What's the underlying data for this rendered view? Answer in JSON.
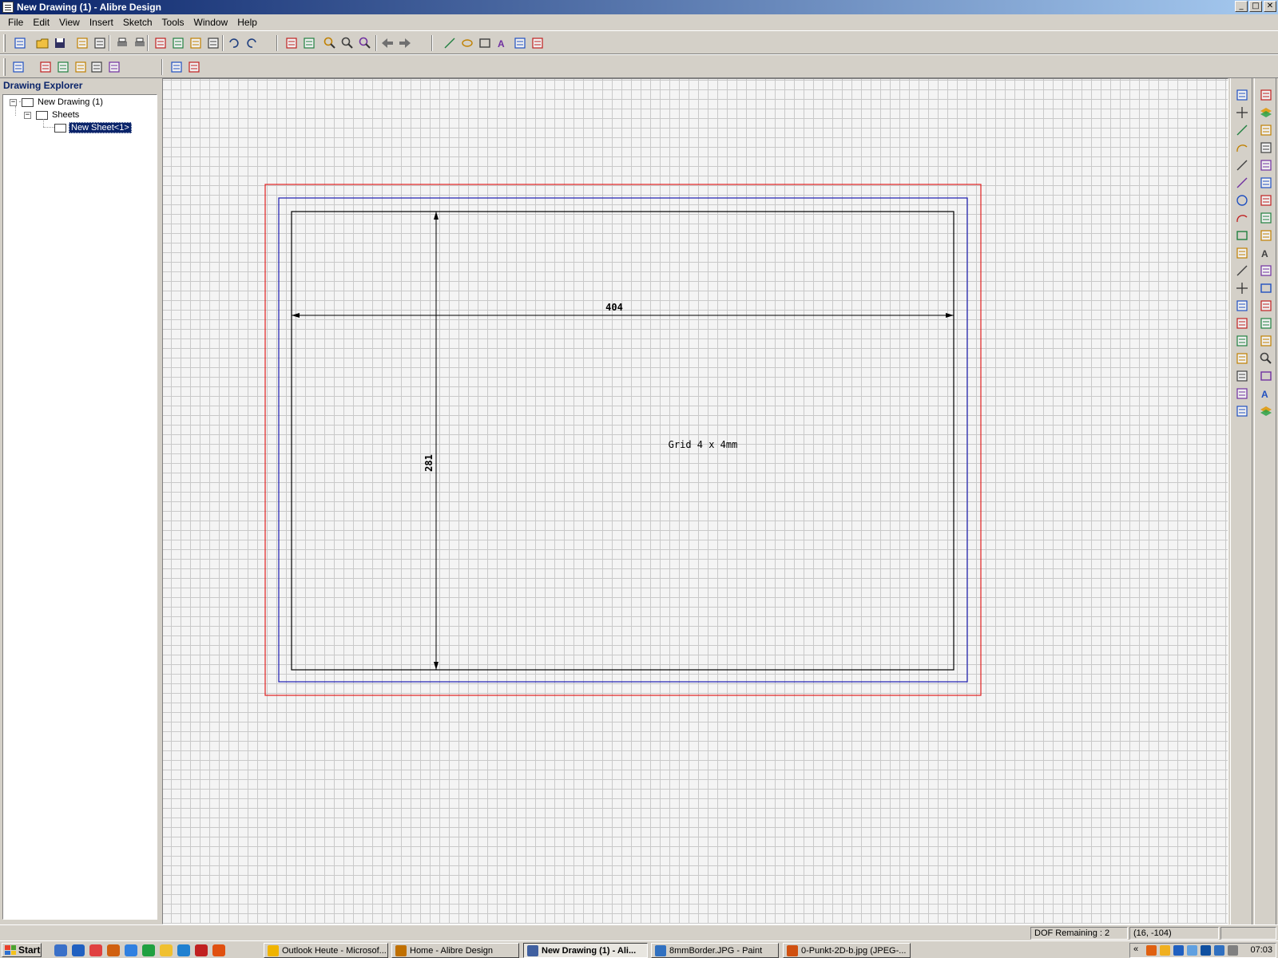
{
  "window": {
    "title": "New Drawing (1) - Alibre Design",
    "minimize": "_",
    "maximize": "□",
    "close": "✕"
  },
  "menu": [
    "File",
    "Edit",
    "View",
    "Insert",
    "Sketch",
    "Tools",
    "Window",
    "Help"
  ],
  "toolbar1": [
    "new-icon",
    "open-icon",
    "save-icon",
    "copy-doc-icon",
    "paste-doc-icon",
    "print-icon",
    "print-preview-icon",
    "cut-icon",
    "copy-icon",
    "paste-icon",
    "delete-icon",
    "undo-icon",
    "redo-icon",
    "select-icon",
    "select-window-icon",
    "zoom-in-icon",
    "zoom-window-icon",
    "zoom-icon",
    "back-arrow-icon",
    "forward-arrow-icon",
    "sketch-line-icon",
    "ellipse-icon",
    "rectangle-icon",
    "text-icon",
    "fill-icon",
    "hatch-icon"
  ],
  "toolbar2": [
    "insert-view-icon",
    "standard-view-icon",
    "section-view-icon",
    "detail-view-icon",
    "broken-view-icon",
    "dimension-view-icon",
    "sheet-add-icon",
    "sheet-remove-icon"
  ],
  "explorer": {
    "title": "Drawing Explorer",
    "tree": {
      "root": "New Drawing (1)",
      "folder": "Sheets",
      "sheet": "New Sheet<1>"
    }
  },
  "drawing": {
    "dimension_horizontal": "404",
    "dimension_vertical": "281",
    "note": "Grid 4 x 4mm",
    "colors": {
      "grid": "#c9c9c9",
      "outer_border": "#e02020",
      "inner_border": "#1a1ab0",
      "frame": "#000000",
      "background": "#f4f4f4"
    }
  },
  "right_toolbar1": [
    "sketch-icon",
    "crosshair-icon",
    "line-icon",
    "arc-dot-icon",
    "diagonal-line-icon",
    "line2-icon",
    "circle-icon",
    "arc-icon",
    "rectangle-icon",
    "polygon-icon",
    "spline-icon",
    "point-icon",
    "hatch-icon",
    "trim-icon",
    "extend-icon",
    "fillet-icon",
    "chamfer-icon",
    "offset-icon",
    "mirror-icon"
  ],
  "right_toolbar2": [
    "new-sheet-icon",
    "layers-icon",
    "properties-icon",
    "bom-icon",
    "balloon-icon",
    "weld-icon",
    "surface-finish-icon",
    "datum-icon",
    "center-mark-icon",
    "note-icon",
    "gd-t-icon",
    "hole-table-icon",
    "revision-icon",
    "check-icon",
    "angle-icon",
    "search-icon",
    "table-icon",
    "text-style-icon",
    "layer-stack-icon"
  ],
  "status": {
    "dof": "DOF Remaining : 2",
    "coords": "(16, -104)"
  },
  "taskbar": {
    "start": "Start",
    "tasks": [
      {
        "label": "Outlook Heute - Microsof...",
        "color": "#f0b400"
      },
      {
        "label": "Home - Alibre Design",
        "color": "#c07000"
      },
      {
        "label": "New Drawing (1) - Ali...",
        "color": "#4060a0"
      },
      {
        "label": "8mmBorder.JPG - Paint",
        "color": "#3070c0"
      },
      {
        "label": "0-Punkt-2D-b.jpg (JPEG-...",
        "color": "#d05010"
      }
    ],
    "time": "07:03",
    "tray_chevron": "«"
  }
}
